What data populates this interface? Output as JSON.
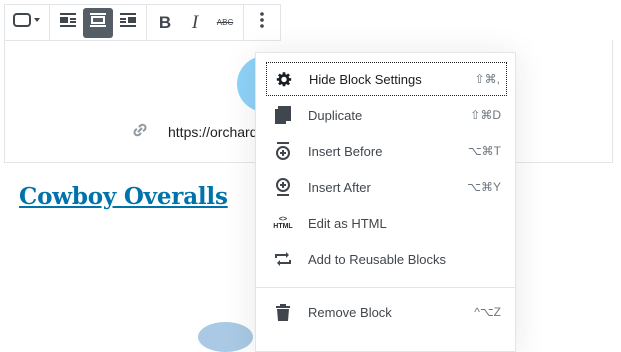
{
  "toolbar": {
    "buttons": [
      {
        "name": "block-style-button",
        "icon": "rectangle-dropdown-icon"
      },
      {
        "name": "align-left-button",
        "icon": "align-left-icon"
      },
      {
        "name": "align-center-button",
        "icon": "align-center-icon",
        "active": true
      },
      {
        "name": "align-right-button",
        "icon": "align-right-icon"
      },
      {
        "name": "bold-button",
        "label": "B"
      },
      {
        "name": "italic-button",
        "label": "I"
      },
      {
        "name": "strikethrough-button",
        "label": "ABC"
      },
      {
        "name": "more-options-button",
        "icon": "vertical-ellipsis-icon"
      }
    ]
  },
  "block": {
    "link_url": "https://orchard"
  },
  "heading": {
    "title": "Cowboy Overalls"
  },
  "menu": {
    "items": [
      {
        "label": "Hide Block Settings",
        "shortcut": "⇧⌘,",
        "icon": "gear-icon"
      },
      {
        "label": "Duplicate",
        "shortcut": "⇧⌘D",
        "icon": "duplicate-icon"
      },
      {
        "label": "Insert Before",
        "shortcut": "⌥⌘T",
        "icon": "insert-before-icon"
      },
      {
        "label": "Insert After",
        "shortcut": "⌥⌘Y",
        "icon": "insert-after-icon"
      },
      {
        "label": "Edit as HTML",
        "shortcut": "",
        "icon": "html-icon"
      },
      {
        "label": "Add to Reusable Blocks",
        "shortcut": "",
        "icon": "reusable-block-icon"
      },
      {
        "label": "Remove Block",
        "shortcut": "^⌥Z",
        "icon": "trash-icon"
      }
    ],
    "html_icon_text": "HTML"
  },
  "colors": {
    "accent": "#0073aa",
    "toolbar_active": "#555d66",
    "avatar": "#8fd3f8"
  }
}
